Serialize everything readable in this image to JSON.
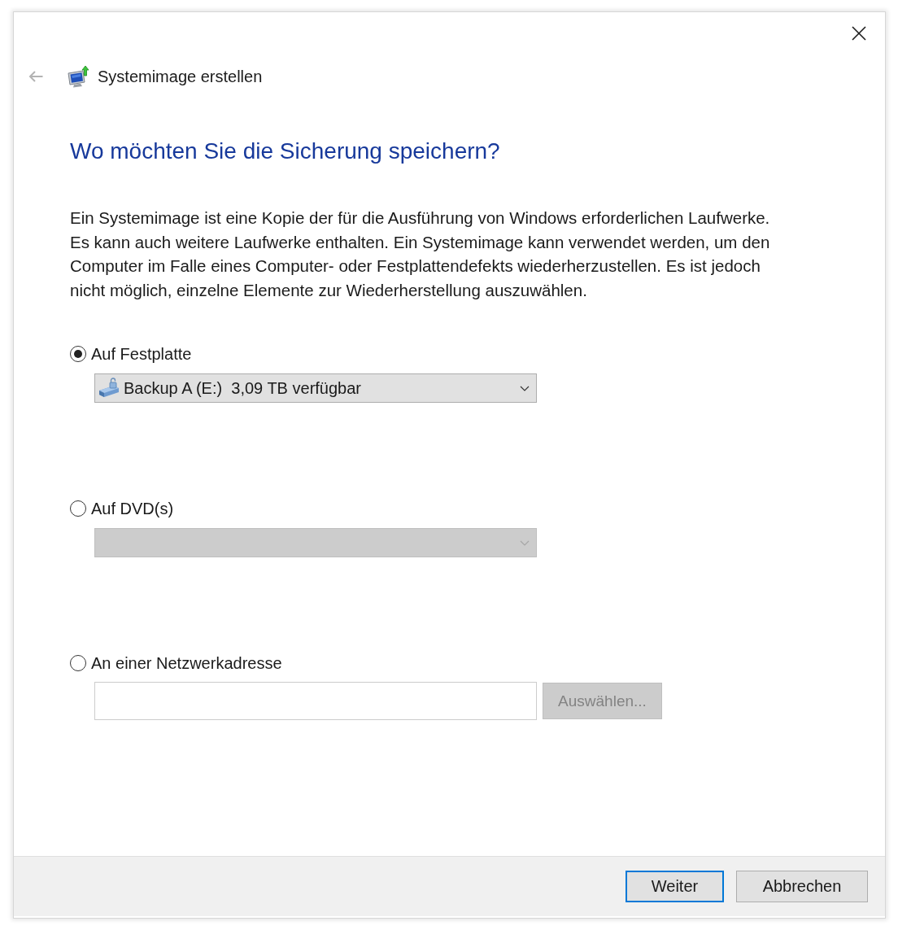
{
  "window": {
    "title": "Systemimage erstellen"
  },
  "back_button": {
    "disabled": true
  },
  "heading": "Wo möchten Sie die Sicherung speichern?",
  "description": "Ein Systemimage ist eine Kopie der für die Ausführung von Windows erforderlichen Laufwerke. Es kann auch weitere Laufwerke enthalten. Ein Systemimage kann verwendet werden, um den Computer im Falle eines Computer- oder Festplattendefekts wiederherzustellen. Es ist jedoch nicht möglich, einzelne Elemente zur Wiederherstellung auszuwählen.",
  "options": [
    {
      "kind": "dropdown",
      "label": "Auf Festplatte",
      "selected": true,
      "disabled": false,
      "value": "Backup A (E:)  3,09 TB verfügbar"
    },
    {
      "kind": "dropdown",
      "label": "Auf DVD(s)",
      "selected": false,
      "disabled": true
    },
    {
      "kind": "path",
      "label": "An einer Netzwerkadresse",
      "selected": false,
      "button": {
        "label": "Auswählen...",
        "disabled": true
      }
    }
  ],
  "buttons": [
    {
      "label": "Weiter",
      "default": true
    },
    {
      "label": "Abbrechen",
      "default": false
    }
  ]
}
